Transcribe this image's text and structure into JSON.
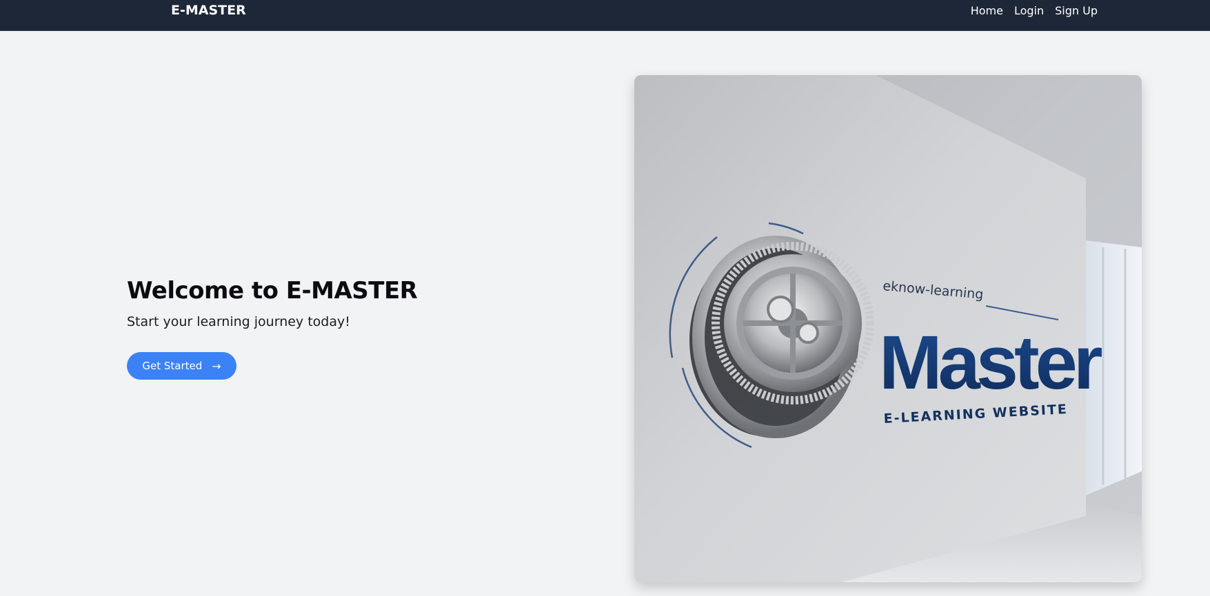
{
  "navbar": {
    "brand": "E-MASTER",
    "links": [
      "Home",
      "Login",
      "Sign Up"
    ]
  },
  "hero": {
    "title": "Welcome to E-MASTER",
    "subtitle": "Start your learning journey today!",
    "cta_label": "Get Started",
    "cta_icon": "arrow-right-icon"
  },
  "logo_image": {
    "tagline": "eknow-learning",
    "wordmark": "Master",
    "caption": "E-LEARNING WEBSITE"
  },
  "colors": {
    "navbar_bg": "#1e2738",
    "page_bg": "#f2f3f5",
    "accent": "#3b82f6",
    "logo_blue": "#163a73"
  }
}
